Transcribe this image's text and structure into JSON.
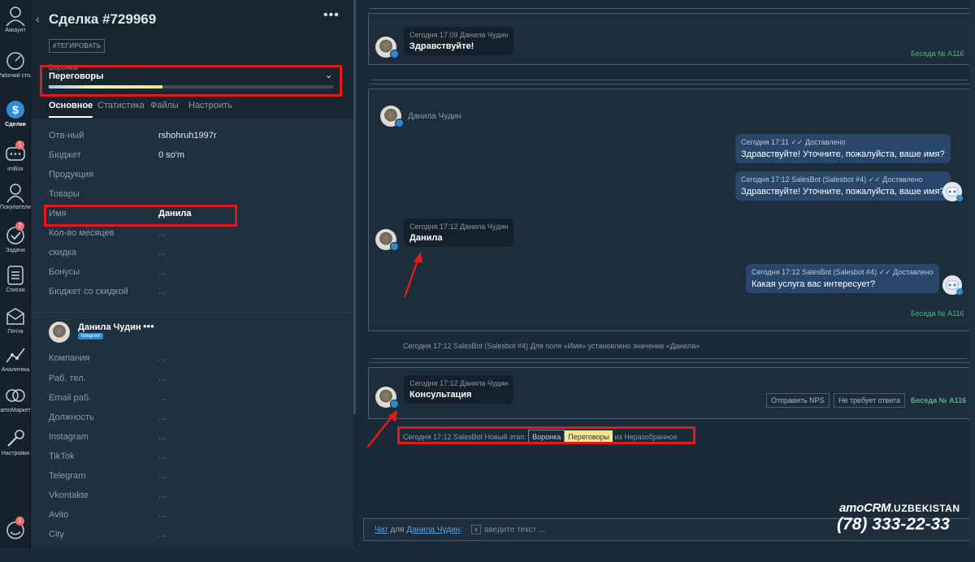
{
  "nav": {
    "items": [
      {
        "label": "Аккаунт",
        "icon": "user-icon"
      },
      {
        "label": "Рабочий стол",
        "icon": "dashboard-icon"
      },
      {
        "label": "Сделки",
        "icon": "deals-icon",
        "active": true
      },
      {
        "label": "imBox",
        "icon": "chat-icon",
        "badge": "1"
      },
      {
        "label": "Покупатели",
        "icon": "customers-icon"
      },
      {
        "label": "Задачи",
        "icon": "tasks-icon",
        "badge": "2"
      },
      {
        "label": "Списки",
        "icon": "lists-icon"
      },
      {
        "label": "Почта",
        "icon": "mail-icon"
      },
      {
        "label": "Аналитика",
        "icon": "analytics-icon"
      },
      {
        "label": "amoМаркет",
        "icon": "market-icon"
      },
      {
        "label": "Настройки",
        "icon": "settings-icon"
      }
    ],
    "bottom_badge": "1"
  },
  "deal": {
    "title": "Сделка #729969",
    "tag_button": "#ТЕГИРОВАТЬ",
    "pipeline_label": "Воронка",
    "pipeline_value": "Переговоры",
    "pipeline_progress": 0.4,
    "tabs": [
      "Основное",
      "Статистика",
      "Файлы",
      "Настроить"
    ],
    "fields": [
      {
        "label": "Отв-ный",
        "value": "rshohruh1997r"
      },
      {
        "label": "Бюджет",
        "value": "0 so'm"
      },
      {
        "label": "Продукция",
        "value": ""
      },
      {
        "label": "Товары",
        "value": ""
      },
      {
        "label": "Имя",
        "value": "Данила"
      },
      {
        "label": "Кол-во месяцев",
        "value": "..."
      },
      {
        "label": "скидка",
        "value": "..."
      },
      {
        "label": "Бонусы",
        "value": "..."
      },
      {
        "label": "Бюджет со скидкой",
        "value": "..."
      }
    ]
  },
  "contact": {
    "name": "Данила Чудин",
    "more": "•••",
    "badge": "Telegram",
    "fields": [
      {
        "label": "Компания",
        "value": "..."
      },
      {
        "label": "Раб. тел.",
        "value": "..."
      },
      {
        "label": "Email раб.",
        "value": "..."
      },
      {
        "label": "Должность",
        "value": "..."
      },
      {
        "label": "Instagram",
        "value": "..."
      },
      {
        "label": "TikTok",
        "value": "..."
      },
      {
        "label": "Telegram",
        "value": "..."
      },
      {
        "label": "Vkontakte",
        "value": "..."
      },
      {
        "label": "Avito",
        "value": "..."
      },
      {
        "label": "City",
        "value": "..."
      }
    ]
  },
  "feed": {
    "card1": {
      "meta": "Сегодня 17:09 Данила Чудин",
      "text": "Здравствуйте!",
      "conv": "Беседа № A116"
    },
    "card2": {
      "header_name": "Данила Чудин",
      "out1_meta": "Сегодня 17:11 ✓✓ Доставлено",
      "out1_text": "Здравствуйте! Уточните, пожалуйста, ваше имя?",
      "out2_meta": "Сегодня 17:12 SalesBot (Salesbot #4) ✓✓ Доставлено",
      "out2_text": "Здравствуйте! Уточните, пожалуйста, ваше имя?",
      "in_meta": "Сегодня 17:12 Данила Чудин",
      "in_text": "Данила",
      "out3_meta": "Сегодня 17:12 SalesBot (Salesbot #4) ✓✓ Доставлено",
      "out3_text": "Какая услуга вас интересует?",
      "conv": "Беседа № A116"
    },
    "system1": "Сегодня 17:12 SalesBot (Salesbot #4) Для поля «Имя» установлено значение «Данила»",
    "card3": {
      "meta": "Сегодня 17:12 Данила Чудин",
      "text": "Консультация",
      "btn_nps": "Отправить NPS",
      "btn_no_reply": "Не требует ответа",
      "conv": "Беседа № A116"
    },
    "system2": {
      "prefix": "Сегодня 17:12 SalesBot Новый этап:",
      "pipeline": "Воронка",
      "stage": "Переговоры",
      "suffix": "из Неразобранное"
    }
  },
  "chat": {
    "prefix": "Чат",
    "for": "для",
    "contact": "Данила Чудин",
    "colon": ":",
    "placeholder": "введите текст ..."
  },
  "brand": {
    "logo_main": "amoCRM",
    "logo_suffix": ".UZBEKISTAN",
    "phone": "(78) 333-22-33"
  },
  "colors": {
    "highlight_box": "#e11a1a",
    "conv_green": "#4fb783",
    "outgoing_bubble": "#28476a",
    "stage_yellow": "#f6e58d"
  }
}
